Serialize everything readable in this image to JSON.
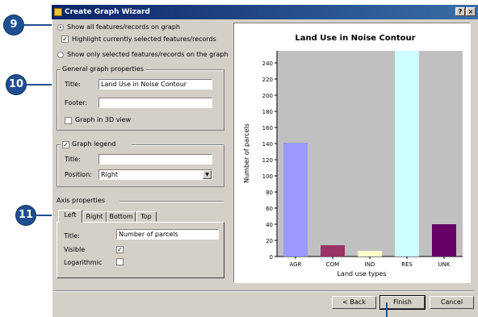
{
  "window": {
    "title": "Create Graph Wizard",
    "help_btn": "?",
    "close_btn": "×"
  },
  "callouts": {
    "c9": "9",
    "c10": "10",
    "c11": "11"
  },
  "display_options": {
    "show_all": "Show all features/records on graph",
    "highlight": "Highlight currently selected features/records",
    "show_only": "Show only selected features/records on the graph",
    "show_all_selected": true,
    "highlight_checked": true
  },
  "general": {
    "group_label": "General graph properties",
    "title_label": "Title:",
    "title_value": "Land Use in Noise Contour",
    "footer_label": "Footer:",
    "footer_value": "",
    "graph3d_label": "Graph in 3D view",
    "graph3d_checked": false
  },
  "legend": {
    "label": "Graph legend",
    "checked": true,
    "title_label": "Title:",
    "title_value": "",
    "position_label": "Position:",
    "position_value": "Right"
  },
  "axis": {
    "group_label": "Axis properties",
    "tabs": [
      "Left",
      "Right",
      "Bottom",
      "Top"
    ],
    "active_tab": "Left",
    "title_label": "Title:",
    "title_value": "Number of parcels",
    "visible_label": "Visible",
    "visible_checked": true,
    "log_label": "Logarithmic",
    "log_checked": false
  },
  "buttons": {
    "back": "< Back",
    "finish": "Finish",
    "cancel": "Cancel"
  },
  "chart_data": {
    "type": "bar",
    "title": "Land Use in Noise Contour",
    "xlabel": "Land use types",
    "ylabel": "Number of parcels",
    "categories": [
      "AGR",
      "COM",
      "IND",
      "RES",
      "UNK"
    ],
    "values": [
      141,
      14,
      7,
      255,
      40
    ],
    "colors": [
      "#9999ff",
      "#993366",
      "#ffffcc",
      "#ccffff",
      "#660066"
    ],
    "ylim": [
      0,
      255
    ],
    "yticks": [
      0,
      20,
      40,
      60,
      80,
      100,
      120,
      140,
      160,
      180,
      200,
      220,
      240
    ],
    "grid": false,
    "plot_background": "#c0c0c0"
  }
}
